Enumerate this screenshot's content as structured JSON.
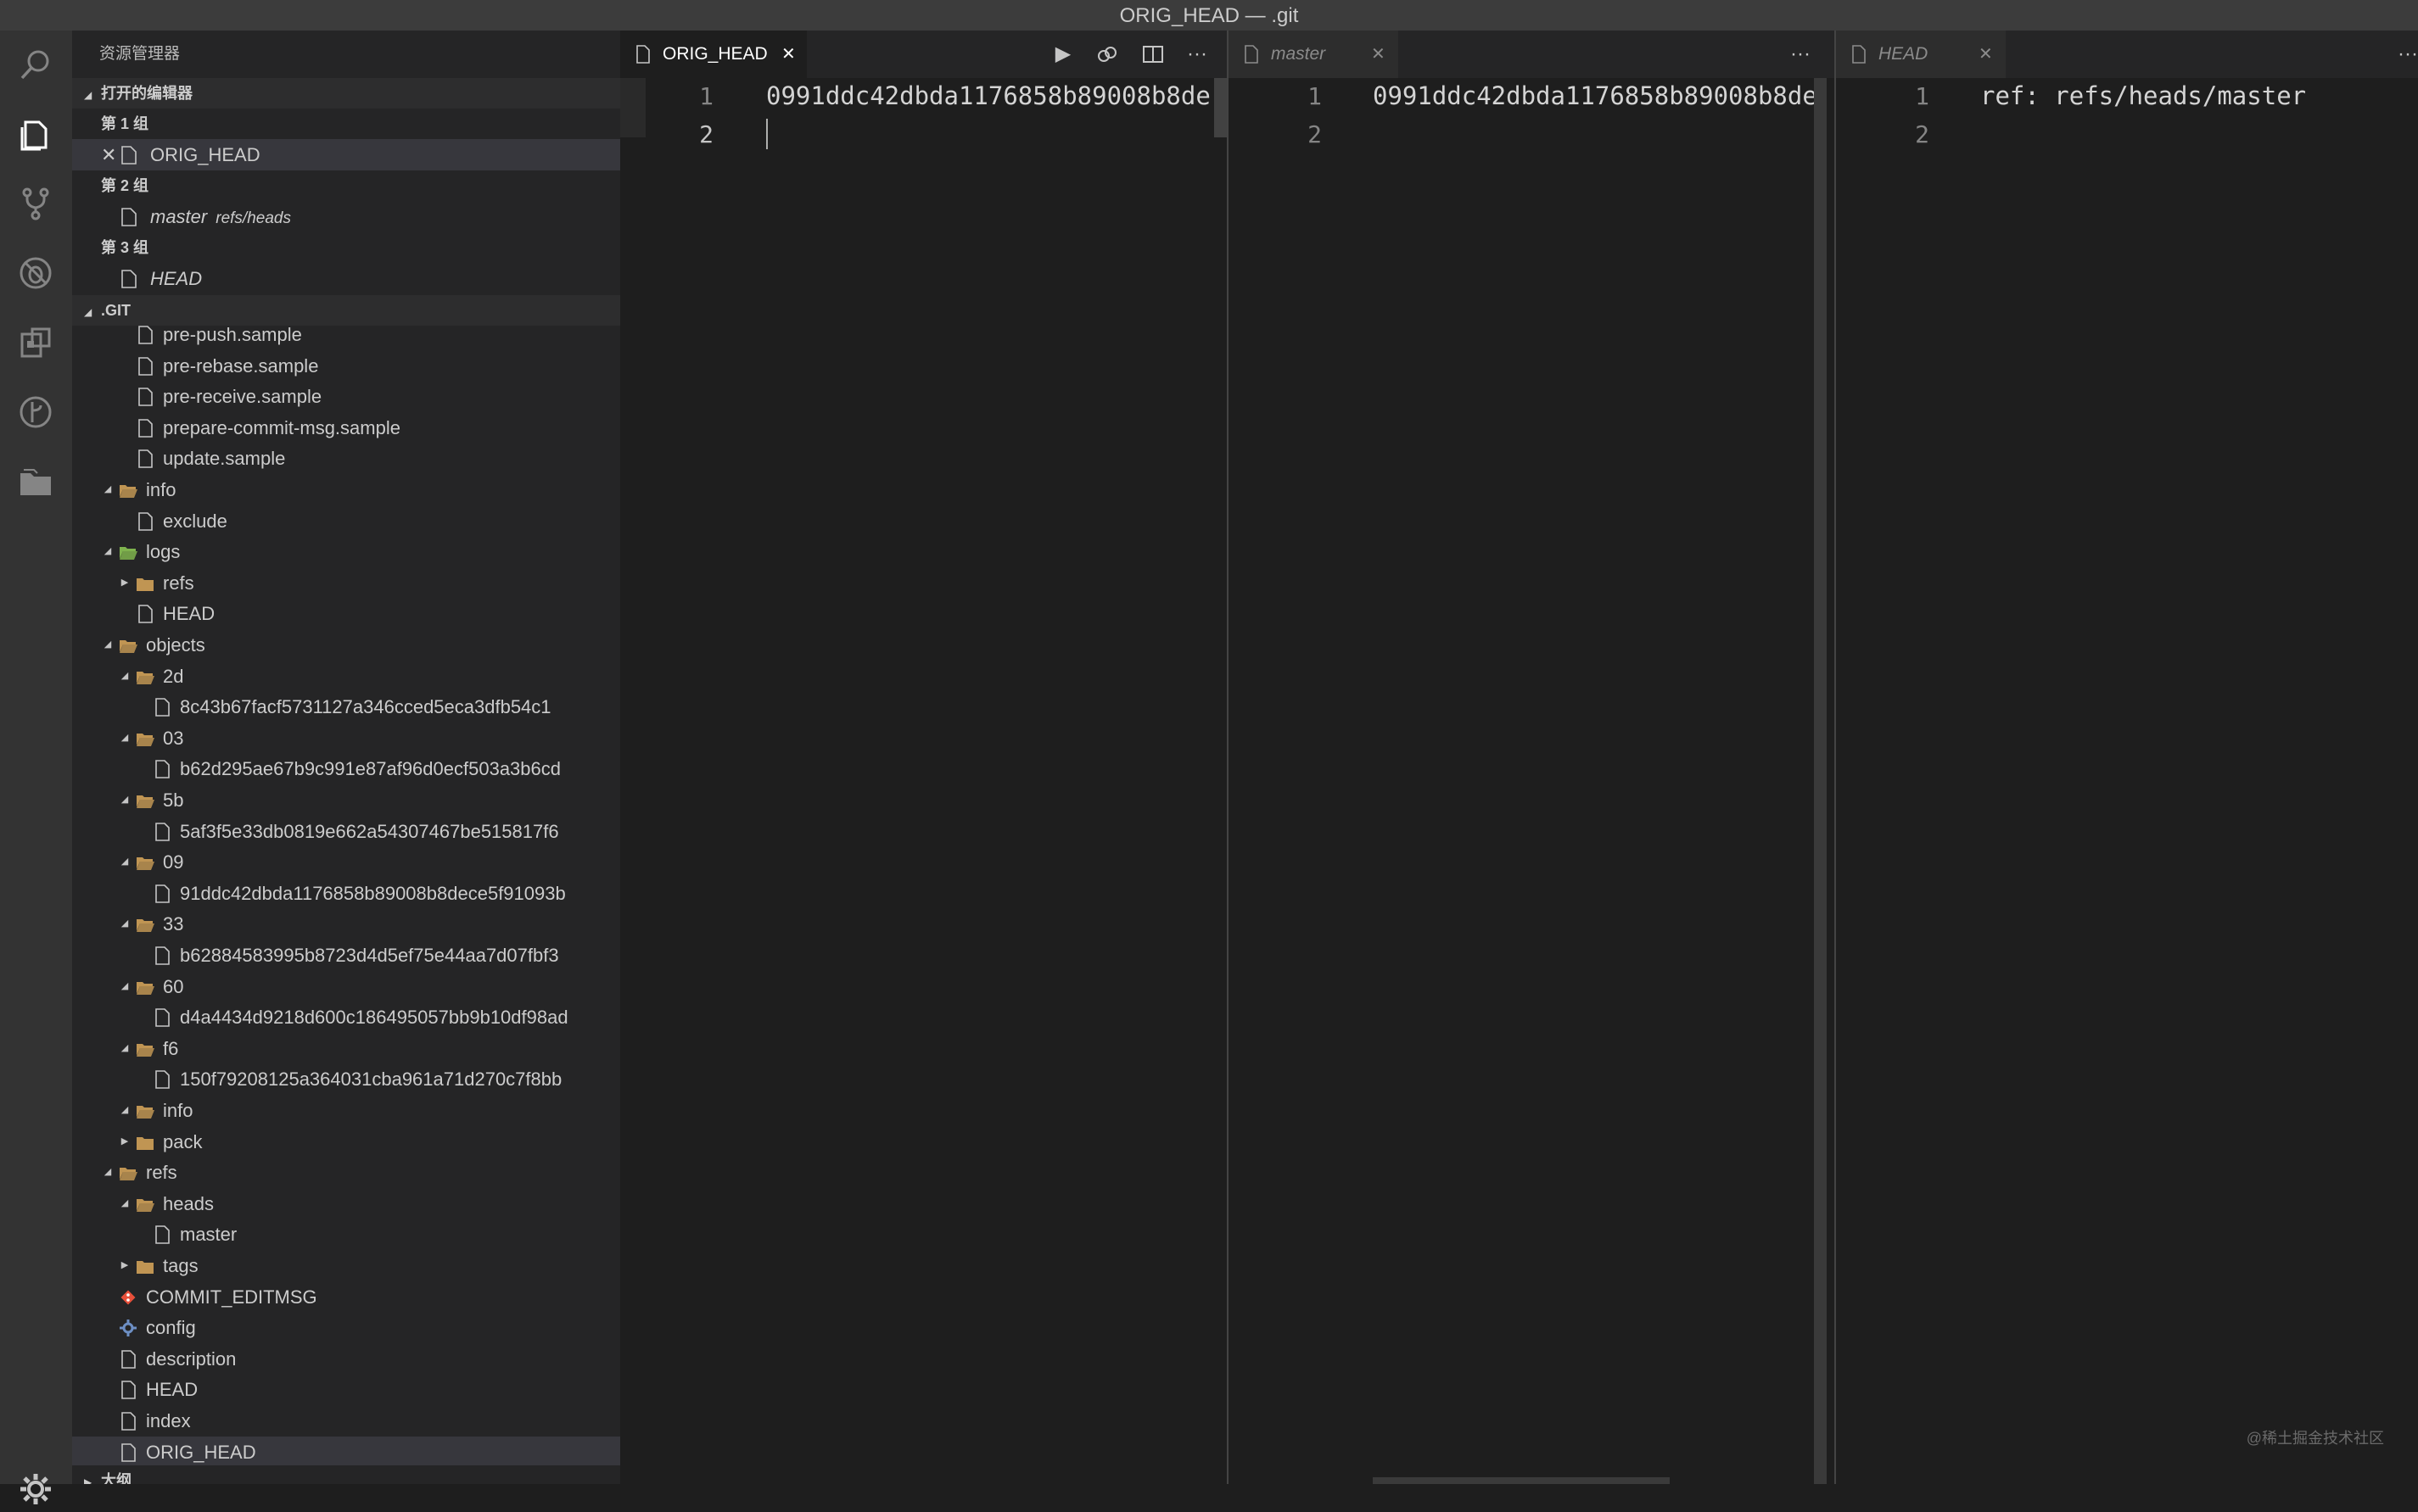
{
  "window": {
    "title": "ORIG_HEAD — .git"
  },
  "activity_bar": {
    "icons": [
      "search-icon",
      "explorer-icon",
      "source-control-icon",
      "no-bug-icon",
      "extensions-icon",
      "git-graph-icon",
      "project-manager-icon"
    ],
    "settings_icon": "gear-icon"
  },
  "sidebar": {
    "title": "资源管理器",
    "open_editors": {
      "header": "打开的编辑器",
      "groups": [
        {
          "label": "第 1 组",
          "files": [
            {
              "name": "ORIG_HEAD",
              "desc": ""
            }
          ]
        },
        {
          "label": "第 2 组",
          "files": [
            {
              "name": "master",
              "desc": "refs/heads"
            }
          ]
        },
        {
          "label": "第 3 组",
          "files": [
            {
              "name": "HEAD",
              "desc": ""
            }
          ]
        }
      ]
    },
    "folder_header": ".GIT",
    "tree": [
      {
        "label": "pre-push.sample",
        "kind": "file",
        "depth": 2
      },
      {
        "label": "pre-rebase.sample",
        "kind": "file",
        "depth": 2
      },
      {
        "label": "pre-receive.sample",
        "kind": "file",
        "depth": 2
      },
      {
        "label": "prepare-commit-msg.sample",
        "kind": "file",
        "depth": 2
      },
      {
        "label": "update.sample",
        "kind": "file",
        "depth": 2
      },
      {
        "label": "info",
        "kind": "folder-open",
        "depth": 1
      },
      {
        "label": "exclude",
        "kind": "file",
        "depth": 2
      },
      {
        "label": "logs",
        "kind": "folder-open-green",
        "depth": 1
      },
      {
        "label": "refs",
        "kind": "folder-closed",
        "depth": 2
      },
      {
        "label": "HEAD",
        "kind": "file",
        "depth": 2
      },
      {
        "label": "objects",
        "kind": "folder-open",
        "depth": 1
      },
      {
        "label": "2d",
        "kind": "folder-open",
        "depth": 2
      },
      {
        "label": "8c43b67facf5731127a346cced5eca3dfb54c1",
        "kind": "file",
        "depth": 3
      },
      {
        "label": "03",
        "kind": "folder-open",
        "depth": 2
      },
      {
        "label": "b62d295ae67b9c991e87af96d0ecf503a3b6cd",
        "kind": "file",
        "depth": 3
      },
      {
        "label": "5b",
        "kind": "folder-open",
        "depth": 2
      },
      {
        "label": "5af3f5e33db0819e662a54307467be515817f6",
        "kind": "file",
        "depth": 3
      },
      {
        "label": "09",
        "kind": "folder-open",
        "depth": 2
      },
      {
        "label": "91ddc42dbda1176858b89008b8dece5f91093b",
        "kind": "file",
        "depth": 3
      },
      {
        "label": "33",
        "kind": "folder-open",
        "depth": 2
      },
      {
        "label": "b62884583995b8723d4d5ef75e44aa7d07fbf3",
        "kind": "file",
        "depth": 3
      },
      {
        "label": "60",
        "kind": "folder-open",
        "depth": 2
      },
      {
        "label": "d4a4434d9218d600c186495057bb9b10df98ad",
        "kind": "file",
        "depth": 3
      },
      {
        "label": "f6",
        "kind": "folder-open",
        "depth": 2
      },
      {
        "label": "150f79208125a364031cba961a71d270c7f8bb",
        "kind": "file",
        "depth": 3
      },
      {
        "label": "info",
        "kind": "folder-open",
        "depth": 2
      },
      {
        "label": "pack",
        "kind": "folder-closed",
        "depth": 2
      },
      {
        "label": "refs",
        "kind": "folder-open",
        "depth": 1
      },
      {
        "label": "heads",
        "kind": "folder-open",
        "depth": 2
      },
      {
        "label": "master",
        "kind": "file",
        "depth": 3
      },
      {
        "label": "tags",
        "kind": "folder-closed",
        "depth": 2
      },
      {
        "label": "COMMIT_EDITMSG",
        "kind": "git-file",
        "depth": 1
      },
      {
        "label": "config",
        "kind": "config-file",
        "depth": 1
      },
      {
        "label": "description",
        "kind": "file",
        "depth": 1
      },
      {
        "label": "HEAD",
        "kind": "file",
        "depth": 1
      },
      {
        "label": "index",
        "kind": "file",
        "depth": 1
      },
      {
        "label": "ORIG_HEAD",
        "kind": "file",
        "depth": 1,
        "selected": true
      }
    ],
    "outline_header": "大纲"
  },
  "editors": [
    {
      "tab": {
        "label": "ORIG_HEAD",
        "active": true,
        "italic": false
      },
      "toolbar": [
        "run-icon",
        "open-changes-icon",
        "split-editor-icon",
        "more-actions-icon"
      ],
      "lines": [
        {
          "num": "1",
          "text": "0991ddc42dbda1176858b89008b8de"
        },
        {
          "num": "2",
          "text": ""
        }
      ]
    },
    {
      "tab": {
        "label": "master",
        "active": false,
        "italic": true
      },
      "toolbar": [
        "more-actions-icon"
      ],
      "lines": [
        {
          "num": "1",
          "text": "0991ddc42dbda1176858b89008b8de"
        },
        {
          "num": "2",
          "text": ""
        }
      ]
    },
    {
      "tab": {
        "label": "HEAD",
        "active": false,
        "italic": true
      },
      "toolbar": [
        "more-actions-icon"
      ],
      "lines": [
        {
          "num": "1",
          "text": "ref: refs/heads/master"
        },
        {
          "num": "2",
          "text": ""
        }
      ]
    }
  ],
  "watermark": "@稀土掘金技术社区",
  "colors": {
    "accent": "#cccccc",
    "folder": "#c09553",
    "folder_green": "#7fb34e",
    "git": "#e8503a"
  }
}
